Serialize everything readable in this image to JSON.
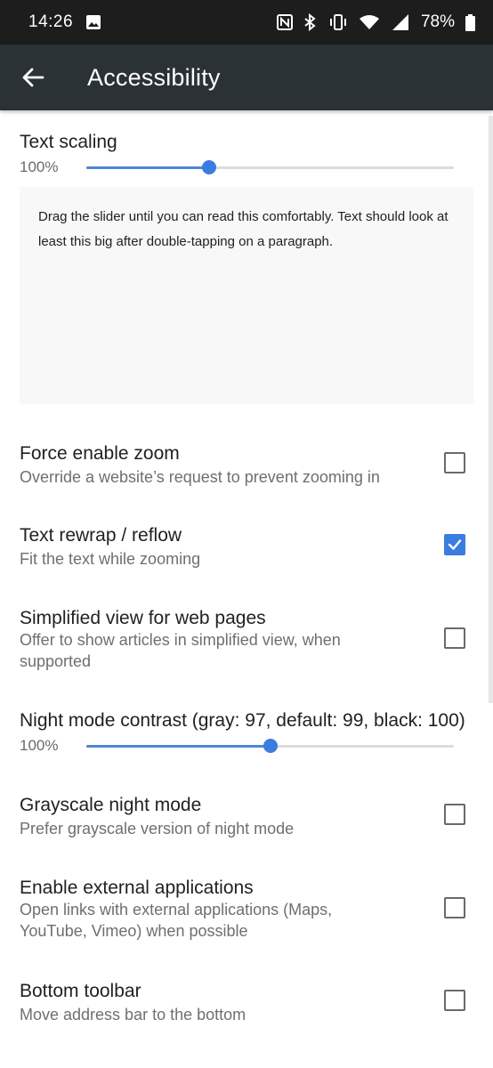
{
  "status_bar": {
    "time": "14:26",
    "battery": "78%",
    "icons": [
      "image-icon",
      "nfc-icon",
      "bluetooth-icon",
      "vibrate-icon",
      "wifi-icon",
      "signal-icon",
      "battery-icon"
    ]
  },
  "app_bar": {
    "title": "Accessibility",
    "back_icon": "arrow-left-icon"
  },
  "text_scaling": {
    "title": "Text scaling",
    "value_label": "100%",
    "fraction": 0.333,
    "preview_text": "Drag the slider until you can read this comfortably. Text should look at least this big after double-tapping on a paragraph."
  },
  "preferences": [
    {
      "title": "Force enable zoom",
      "summary": "Override a website’s request to prevent zooming in",
      "checked": false
    },
    {
      "title": "Text rewrap / reflow",
      "summary": "Fit the text while zooming",
      "checked": true
    },
    {
      "title": "Simplified view for web pages",
      "summary": "Offer to show articles in simplified view, when supported",
      "checked": false
    }
  ],
  "night_mode": {
    "title": "Night mode contrast (gray: 97, default: 99, black: 100)",
    "value_label": "100%",
    "fraction": 0.5
  },
  "preferences2": [
    {
      "title": "Grayscale night mode",
      "summary": "Prefer grayscale version of night mode",
      "checked": false
    },
    {
      "title": "Enable external applications",
      "summary": "Open links with external applications (Maps, YouTube, Vimeo) when possible",
      "checked": false
    },
    {
      "title": "Bottom toolbar",
      "summary": "Move address bar to the bottom",
      "checked": false
    }
  ],
  "colors": {
    "accent": "#3b7ce0",
    "app_bar": "#2b3236",
    "status_bar": "#1d1d1d"
  }
}
